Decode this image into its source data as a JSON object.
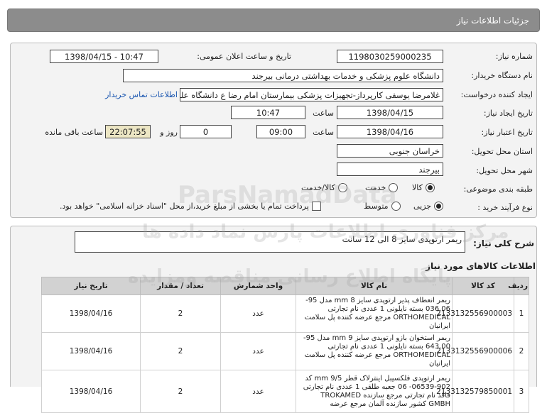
{
  "panel": {
    "title": "جزئیات اطلاعات نیاز"
  },
  "form": {
    "need_number_label": "شماره نیاز:",
    "need_number": "1198030259000235",
    "announce_label": "تاریخ و ساعت اعلان عمومی:",
    "announce_value": "1398/04/15 - 10:47",
    "buyer_label": "نام دستگاه خریدار:",
    "buyer_value": "دانشگاه علوم پزشکی و خدمات بهداشتی درمانی بیرجند",
    "creator_label": "ایجاد کننده درخواست:",
    "creator_value": "غلامرضا یوسفی کارپرداز-تجهیزات پزشکی بیمارستان امام رضا ع دانشگاه علوم پ",
    "contact_link": "اطلاعات تماس خریدار",
    "created_label": "تاریخ ایجاد نیاز:",
    "created_date": "1398/04/15",
    "hour_label": "ساعت",
    "created_time": "10:47",
    "validity_label": "تاریخ اعتبار نیاز:",
    "validity_date": "1398/04/16",
    "validity_time": "09:00",
    "days_value": "0",
    "days_label": "روز و",
    "remaining_time": "22:07:55",
    "remaining_label": "ساعت باقی مانده",
    "province_label": "استان محل تحویل:",
    "province_value": "خراسان جنوبی",
    "city_label": "شهر محل تحویل:",
    "city_value": "بیرجند",
    "category_label": "طبقه بندی موضوعی:",
    "category_options": [
      "کالا",
      "خدمت",
      "کالا/خدمت"
    ],
    "category_selected": "کالا",
    "process_label": "نوع فرآیند خرید :",
    "process_options": [
      "جزیی",
      "متوسط"
    ],
    "process_selected": "جزیی",
    "payment_note": "پرداخت تمام یا بخشی از مبلغ خرید،از محل \"اسناد خزانه اسلامی\" خواهد بود."
  },
  "summary": {
    "label": "شرح کلی نیاز:",
    "value": "ریمر ارتوپدی سایز 8 الی 12 سانت"
  },
  "items_section": {
    "title": "اطلاعات کالاهای مورد نیاز",
    "columns": [
      "ردیف",
      "کد کالا",
      "نام کالا",
      "واحد شمارش",
      "تعداد / مقدار",
      "تاریخ نیاز"
    ],
    "rows": [
      {
        "row": "1",
        "code": "2133132556900003",
        "name": "ریمر انعطاف پذیر ارتوپدی سایز 8 mm مدل 95-036.06 بسته نایلونی 1 عددی نام تجارتی ORTHOMEDICAL مرجع عرضه کننده پل سلامت ایرانیان",
        "unit": "عدد",
        "qty": "2",
        "date": "1398/04/16"
      },
      {
        "row": "2",
        "code": "2133132556900006",
        "name": "ریمر استخوان بازو ارتوپدی سایز 9 mm مدل 95-643.00 بسته نایلونی 1 عددی نام تجارتی ORTHOMEDICAL مرجع عرضه کننده پل سلامت ایرانیان",
        "unit": "عدد",
        "qty": "2",
        "date": "1398/04/16"
      },
      {
        "row": "3",
        "code": "2133132579850001",
        "name": "ریمر ارتوپدی فلکسیبل اینترلاک قطر 9/5 mm کد 902-06539- 06 جعبه طلقی 1 عددی نام تجارتی فاقد نام تجارتی مرجع سازنده TROKAMED GMBH کشور سازنده آلمان مرجع عرضه",
        "unit": "عدد",
        "qty": "2",
        "date": "1398/04/16"
      }
    ]
  },
  "watermark": {
    "brand": "ParsNamadData",
    "line1": "مرکز فناوری اطلاعات پارس نماد داده ها",
    "line2": "پایگاه اطلاع رسانی مناقصه ومزایده"
  }
}
